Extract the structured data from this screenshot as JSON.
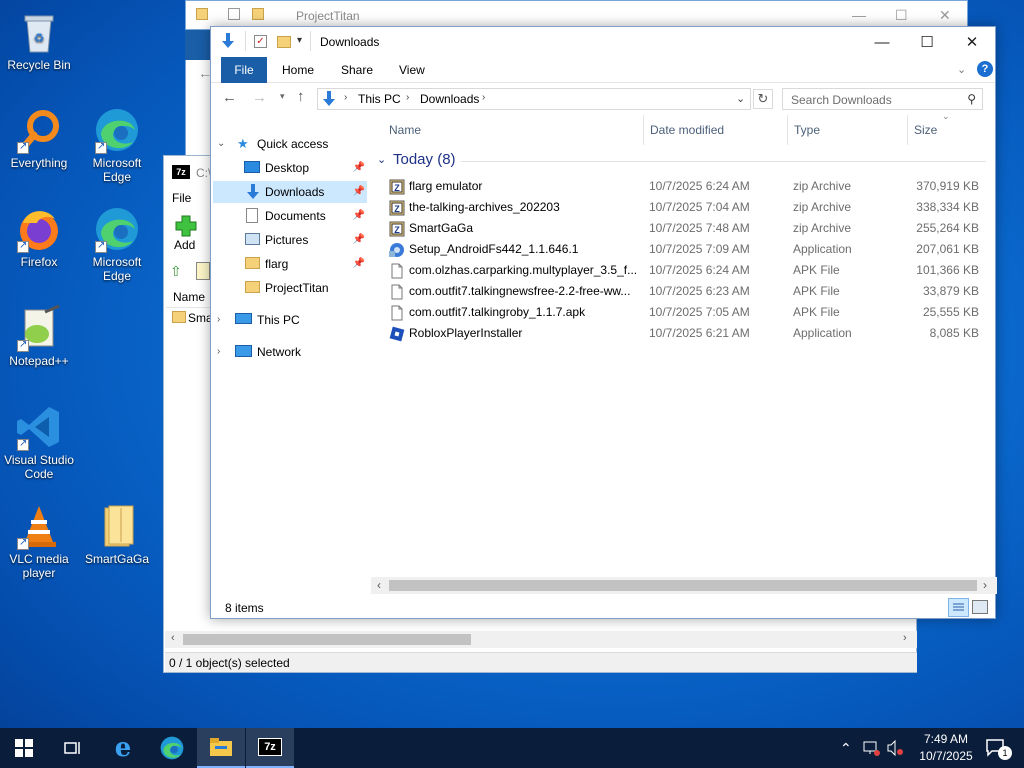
{
  "desktop": {
    "icons": [
      {
        "label": "Recycle Bin",
        "icon": "recycle-bin-icon"
      },
      {
        "label": "Everything",
        "icon": "everything-search-icon"
      },
      {
        "label": "Microsoft Edge",
        "icon": "edge-icon"
      },
      {
        "label": "Firefox",
        "icon": "firefox-icon"
      },
      {
        "label": "Microsoft Edge",
        "icon": "edge-icon"
      },
      {
        "label": "Notepad++",
        "icon": "notepadpp-icon"
      },
      {
        "label": "Visual Studio Code",
        "icon": "vscode-icon"
      },
      {
        "label": "VLC media player",
        "icon": "vlc-icon"
      },
      {
        "label": "SmartGaGa",
        "icon": "folder-icon"
      }
    ]
  },
  "back_window": {
    "title": "ProjectTitan"
  },
  "sevenzip_window": {
    "title": "C:\\",
    "menu_file": "File",
    "add_label": "Add",
    "col_name": "Name",
    "row_name": "Sma",
    "status": "0 / 1 object(s) selected"
  },
  "explorer": {
    "title": "Downloads",
    "ribbon": {
      "file": "File",
      "home": "Home",
      "share": "Share",
      "view": "View"
    },
    "breadcrumb": {
      "root": "This PC",
      "current": "Downloads"
    },
    "search_placeholder": "Search Downloads",
    "nav": {
      "quick_access": "Quick access",
      "desktop": "Desktop",
      "downloads": "Downloads",
      "documents": "Documents",
      "pictures": "Pictures",
      "flarg": "flarg",
      "projecttitan": "ProjectTitan",
      "this_pc": "This PC",
      "network": "Network"
    },
    "columns": {
      "name": "Name",
      "date": "Date modified",
      "type": "Type",
      "size": "Size"
    },
    "group": "Today (8)",
    "files": [
      {
        "name": "flarg emulator",
        "date": "10/7/2025 6:24 AM",
        "type": "zip Archive",
        "size": "370,919 KB",
        "icon": "zip"
      },
      {
        "name": "the-talking-archives_202203",
        "date": "10/7/2025 7:04 AM",
        "type": "zip Archive",
        "size": "338,334 KB",
        "icon": "zip"
      },
      {
        "name": "SmartGaGa",
        "date": "10/7/2025 7:48 AM",
        "type": "zip Archive",
        "size": "255,264 KB",
        "icon": "zip"
      },
      {
        "name": "Setup_AndroidFs442_1.1.646.1",
        "date": "10/7/2025 7:09 AM",
        "type": "Application",
        "size": "207,061 KB",
        "icon": "setup"
      },
      {
        "name": "com.olzhas.carparking.multyplayer_3.5_f...",
        "date": "10/7/2025 6:24 AM",
        "type": "APK File",
        "size": "101,366 KB",
        "icon": "file"
      },
      {
        "name": "com.outfit7.talkingnewsfree-2.2-free-ww...",
        "date": "10/7/2025 6:23 AM",
        "type": "APK File",
        "size": "33,879 KB",
        "icon": "file"
      },
      {
        "name": "com.outfit7.talkingroby_1.1.7.apk",
        "date": "10/7/2025 7:05 AM",
        "type": "APK File",
        "size": "25,555 KB",
        "icon": "file"
      },
      {
        "name": "RobloxPlayerInstaller",
        "date": "10/7/2025 6:21 AM",
        "type": "Application",
        "size": "8,085 KB",
        "icon": "roblox"
      }
    ],
    "status": "8 items"
  },
  "taskbar": {
    "time": "7:49 AM",
    "date": "10/7/2025",
    "notification_count": "1",
    "sevenzip_label": "7z"
  },
  "colors": {
    "accent": "#1a5ea8",
    "selection": "#cce8ff",
    "group_header": "#1e3287"
  }
}
